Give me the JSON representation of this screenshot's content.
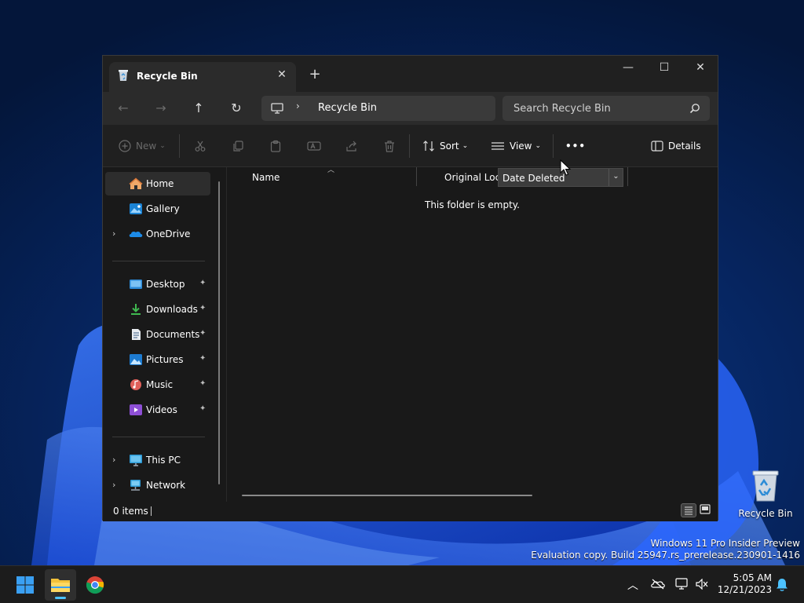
{
  "window": {
    "tab_title": "Recycle Bin",
    "new_tab": "+",
    "minimize": "—",
    "maximize": "☐",
    "close": "✕"
  },
  "navbar": {
    "back": "←",
    "forward": "→",
    "up": "↑",
    "refresh": "↻",
    "breadcrumb_sep": "›",
    "breadcrumb": "Recycle Bin",
    "search_placeholder": "Search Recycle Bin"
  },
  "commandbar": {
    "new_label": "New",
    "sort_label": "Sort",
    "view_label": "View",
    "more_label": "•••",
    "details_label": "Details"
  },
  "sidebar": {
    "items": [
      {
        "label": "Home",
        "icon": "home-icon",
        "selected": true
      },
      {
        "label": "Gallery",
        "icon": "gallery-icon"
      },
      {
        "label": "OneDrive",
        "icon": "onedrive-icon",
        "expandable": true
      },
      {
        "label": "Desktop",
        "icon": "desktop-folder-icon",
        "pinned": true
      },
      {
        "label": "Downloads",
        "icon": "downloads-icon",
        "pinned": true
      },
      {
        "label": "Documents",
        "icon": "documents-icon",
        "pinned": true
      },
      {
        "label": "Pictures",
        "icon": "pictures-icon",
        "pinned": true
      },
      {
        "label": "Music",
        "icon": "music-icon",
        "pinned": true
      },
      {
        "label": "Videos",
        "icon": "videos-icon",
        "pinned": true
      },
      {
        "label": "This PC",
        "icon": "this-pc-icon",
        "expandable": true
      },
      {
        "label": "Network",
        "icon": "network-icon",
        "expandable": true
      }
    ],
    "chevron": "›",
    "pin": "📌"
  },
  "content": {
    "columns": {
      "name": "Name",
      "original_location": "Original Loca",
      "date_deleted": "Date Deleted"
    },
    "empty_message": "This folder is empty."
  },
  "status": {
    "item_count": "0 items"
  },
  "desktop": {
    "recycle_bin_label": "Recycle Bin",
    "watermark_line1": "Windows 11 Pro Insider Preview",
    "watermark_line2": "Evaluation copy. Build 25947.rs_prerelease.230901-1416"
  },
  "taskbar": {
    "time": "5:05 AM",
    "date": "12/21/2023"
  },
  "colors": {
    "accent": "#4cc2ff",
    "window_bg": "#191919",
    "chrome_bg": "#202020"
  }
}
